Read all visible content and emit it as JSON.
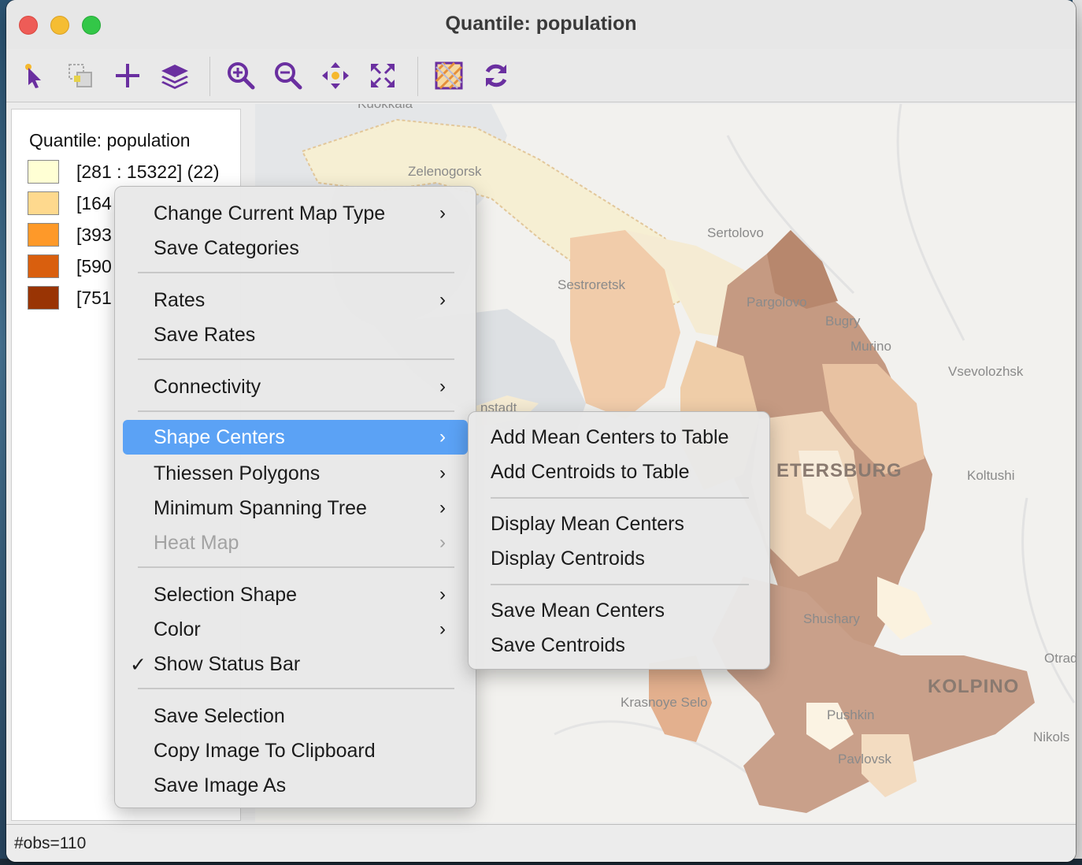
{
  "window": {
    "title": "Quantile: population"
  },
  "toolbar": {
    "buttons": [
      {
        "name": "select-icon"
      },
      {
        "name": "selection-tool-icon"
      },
      {
        "name": "add-icon"
      },
      {
        "name": "layers-icon"
      },
      {
        "name": "zoom-in-icon"
      },
      {
        "name": "zoom-out-icon"
      },
      {
        "name": "pan-icon"
      },
      {
        "name": "fit-extent-icon"
      },
      {
        "name": "basemap-icon"
      },
      {
        "name": "refresh-icon"
      }
    ],
    "accent": "#6a2fa0"
  },
  "legend": {
    "title": "Quantile: population",
    "items": [
      {
        "label": "[281 : 15322] (22)",
        "color": "#ffffd4"
      },
      {
        "label": "[164",
        "color": "#fed98e"
      },
      {
        "label": "[393",
        "color": "#fe9929"
      },
      {
        "label": "[590",
        "color": "#d95f0e"
      },
      {
        "label": "[751",
        "color": "#993404"
      }
    ]
  },
  "map": {
    "labels": [
      "Zelenogorsk",
      "Sertolovo",
      "Sestroretsk",
      "Pargolovo",
      "Bugry",
      "Murino",
      "Vsevolozhsk",
      "nstadt",
      "ETERSBURG",
      "Koltushi",
      "Shushary",
      "Otrad",
      "KOLPINO",
      "Krasnoye Selo",
      "Pushkin",
      "Nikols",
      "Pavlovsk",
      "Kuokkala"
    ]
  },
  "context_menu": {
    "items": [
      {
        "label": "Change Current Map Type",
        "submenu": true
      },
      {
        "label": "Save Categories",
        "submenu": false
      },
      {
        "label": "Rates",
        "submenu": true
      },
      {
        "label": "Save Rates",
        "submenu": false
      },
      {
        "label": "Connectivity",
        "submenu": true
      },
      {
        "label": "Shape Centers",
        "submenu": true,
        "highlighted": true
      },
      {
        "label": "Thiessen Polygons",
        "submenu": true
      },
      {
        "label": "Minimum Spanning Tree",
        "submenu": true
      },
      {
        "label": "Heat Map",
        "submenu": true,
        "disabled": true
      },
      {
        "label": "Selection Shape",
        "submenu": true
      },
      {
        "label": "Color",
        "submenu": true
      },
      {
        "label": "Show Status Bar",
        "submenu": false,
        "checked": true
      },
      {
        "label": "Save Selection",
        "submenu": false
      },
      {
        "label": "Copy Image To Clipboard",
        "submenu": false
      },
      {
        "label": "Save Image As",
        "submenu": false
      }
    ],
    "arrow": "›",
    "check": "✓"
  },
  "submenu": {
    "items": [
      {
        "label": "Add Mean Centers to Table"
      },
      {
        "label": "Add Centroids to Table"
      },
      {
        "label": "Display Mean Centers"
      },
      {
        "label": "Display Centroids"
      },
      {
        "label": "Save Mean Centers"
      },
      {
        "label": "Save Centroids"
      }
    ]
  },
  "status": {
    "text": "#obs=110"
  }
}
